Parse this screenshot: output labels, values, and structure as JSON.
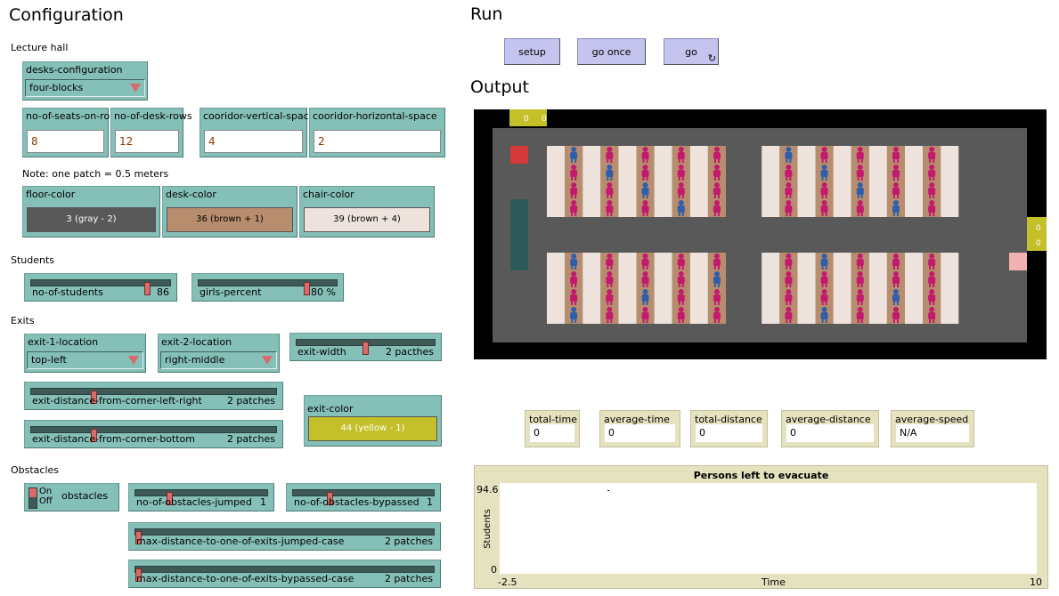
{
  "config": {
    "title": "Configuration",
    "lecture_hall_label": "Lecture hall",
    "desks_configuration": {
      "label": "desks-configuration",
      "value": "four-blocks"
    },
    "inputs": [
      {
        "label": "no-of-seats-on-row",
        "value": "8"
      },
      {
        "label": "no-of-desk-rows",
        "value": "12"
      },
      {
        "label": "cooridor-vertical-space",
        "value": "4"
      },
      {
        "label": "cooridor-horizontal-space",
        "value": "2"
      }
    ],
    "note": "Note: one patch = 0.5 meters",
    "colors": [
      {
        "label": "floor-color",
        "value": "3 (gray - 2)",
        "swatch": "#595959",
        "text_color": "#ffffff"
      },
      {
        "label": "desk-color",
        "value": "36 (brown + 1)",
        "swatch": "#b78d6e",
        "text_color": "#000000"
      },
      {
        "label": "chair-color",
        "value": "39 (brown + 4)",
        "swatch": "#ede3dc",
        "text_color": "#000000"
      }
    ],
    "students_label": "Students",
    "no_of_students": {
      "label": "no-of-students",
      "value": "86",
      "fraction": 0.86
    },
    "girls_percent": {
      "label": "girls-percent",
      "value": "80 %",
      "fraction": 0.8
    },
    "exits_label": "Exits",
    "exit_1_location": {
      "label": "exit-1-location",
      "value": "top-left"
    },
    "exit_2_location": {
      "label": "exit-2-location",
      "value": "right-middle"
    },
    "exit_width": {
      "label": "exit-width",
      "value": "2 pacthes",
      "fraction": 0.5
    },
    "exit_lr": {
      "label": "exit-distance-from-corner-left-right",
      "value": "2 patches",
      "fraction": 0.25
    },
    "exit_bottom": {
      "label": "exit-distance-from-corner-bottom",
      "value": "2 patches",
      "fraction": 0.25
    },
    "exit_color": {
      "label": "exit-color",
      "value": "44 (yellow - 1)",
      "swatch": "#c4c02a"
    },
    "obstacles_label": "Obstacles",
    "obstacles_switch": {
      "on": "On",
      "off": "Off",
      "label": "obstacles"
    },
    "jumped": {
      "label": "no-of-obstacles-jumped",
      "value": "1",
      "fraction": 0.25
    },
    "bypassed": {
      "label": "no-of-obstacles-bypassed",
      "value": "1",
      "fraction": 0.25
    },
    "max_jumped": {
      "label": "max-distance-to-one-of-exits-jumped-case",
      "value": "2 patches",
      "fraction": 0.0
    },
    "max_bypassed": {
      "label": "max-distance-to-one-of-exits-bypassed-case",
      "value": "2 patches",
      "fraction": 0.0
    }
  },
  "run": {
    "title": "Run",
    "buttons": [
      "setup",
      "go once",
      "go"
    ]
  },
  "output": {
    "title": "Output",
    "world_top_labels": [
      "0",
      "0"
    ],
    "world_right_labels": [
      "0",
      "0"
    ],
    "monitors": [
      {
        "label": "total-time",
        "value": "0"
      },
      {
        "label": "average-time",
        "value": "0"
      },
      {
        "label": "total-distance",
        "value": "0"
      },
      {
        "label": "average-distance",
        "value": "0"
      },
      {
        "label": "average-speed",
        "value": "N/A"
      }
    ],
    "plot": {
      "title": "Persons left to evacuate",
      "ylabel": "Students",
      "xlabel": "Time",
      "ymax": "94.6",
      "ymin": "0",
      "xmin": "-2.5",
      "xmax": "10"
    }
  },
  "palette": {
    "floor": "#595959",
    "desk": "#b78d6e",
    "chair": "#ede3dc",
    "exit": "#c4c02a",
    "girl": "#c3196e",
    "boy": "#2f5fa8",
    "exit_red": "#d43a3a"
  }
}
